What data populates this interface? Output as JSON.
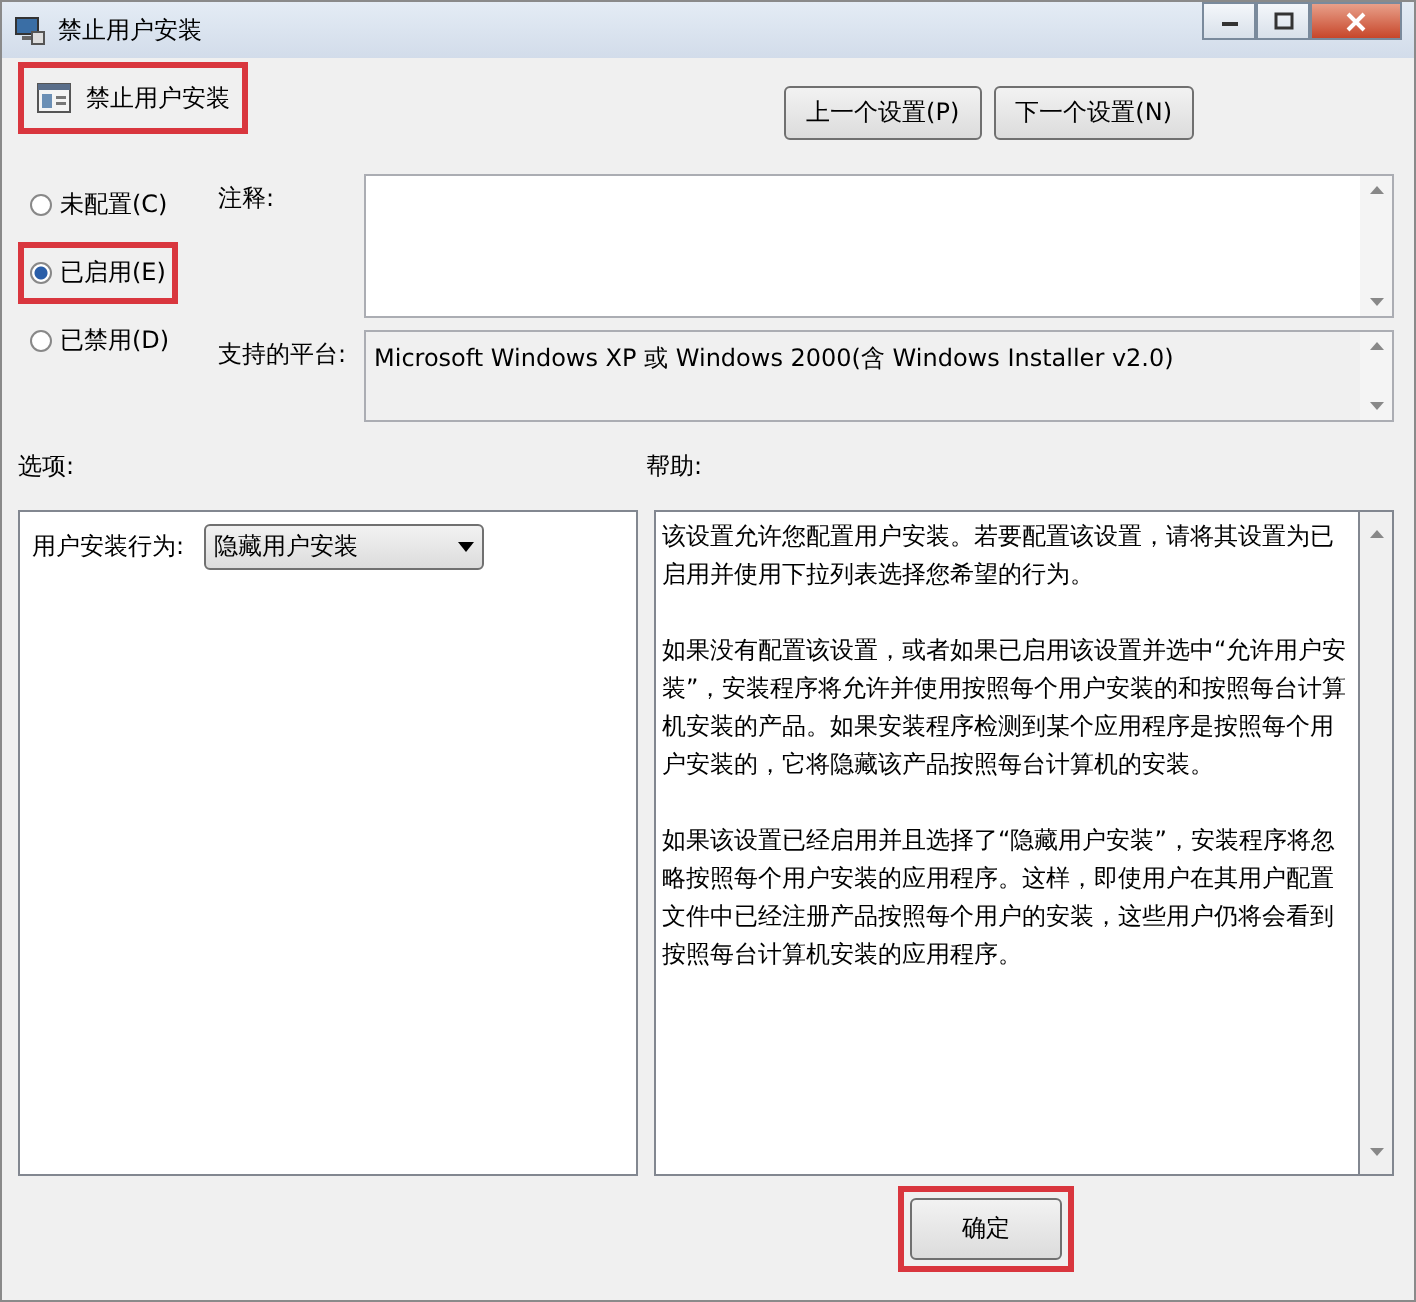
{
  "window": {
    "title": "禁止用户安装"
  },
  "header": {
    "title": "禁止用户安装",
    "highlighted": true
  },
  "nav_buttons": [
    "上一个设置(P)",
    "下一个设置(N)"
  ],
  "radios": [
    {
      "label": "未配置(C)",
      "selected": false,
      "highlighted": false
    },
    {
      "label": "已启用(E)",
      "selected": true,
      "highlighted": true
    },
    {
      "label": "已禁用(D)",
      "selected": false,
      "highlighted": false
    }
  ],
  "comment": {
    "label": "注释:"
  },
  "platform": {
    "label": "支持的平台:",
    "value": "Microsoft Windows XP 或 Windows 2000(含 Windows Installer v2.0)"
  },
  "options": {
    "label": "选项:",
    "field_label": "用户安装行为:",
    "dropdown_value": "隐藏用户安装"
  },
  "help": {
    "label": "帮助:",
    "paragraphs": [
      "该设置允许您配置用户安装。若要配置该设置，请将其设置为已启用并使用下拉列表选择您希望的行为。",
      "如果没有配置该设置，或者如果已启用该设置并选中“允许用户安装”，安装程序将允许并使用按照每个用户安装的和按照每台计算机安装的产品。如果安装程序检测到某个应用程序是按照每个用户安装的，它将隐藏该产品按照每台计算机的安装。",
      "如果该设置已经启用并且选择了“隐藏用户安装”，安装程序将忽略按照每个用户安装的应用程序。这样，即使用户在其用户配置文件中已经注册产品按照每个用户的安装，这些用户仍将会看到按照每台计算机安装的应用程序。"
    ]
  },
  "ok_button": {
    "label": "确定",
    "highlighted": true
  }
}
